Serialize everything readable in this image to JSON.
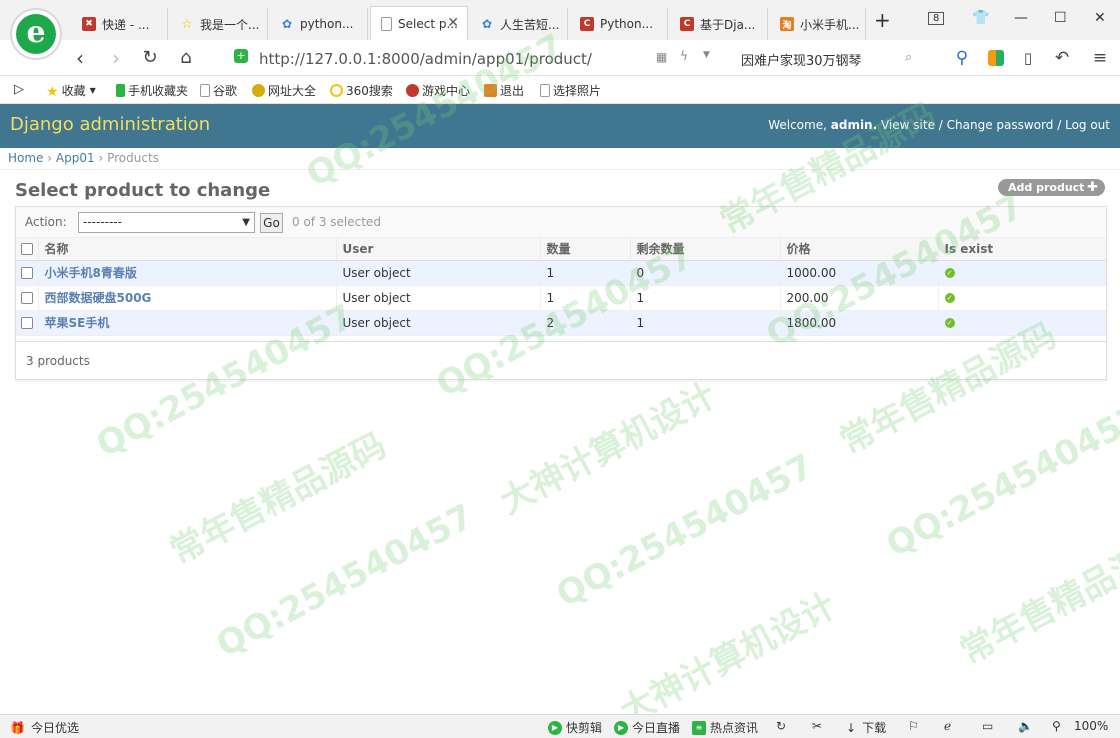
{
  "browser": {
    "tabs": [
      {
        "label": "快递 - ..."
      },
      {
        "label": "我是一个..."
      },
      {
        "label": "python..."
      },
      {
        "label": "Select p..."
      },
      {
        "label": "人生苦短..."
      },
      {
        "label": "Python..."
      },
      {
        "label": "基于Dja..."
      },
      {
        "label": "小米手机..."
      }
    ],
    "tab_count": "8",
    "url": "http://127.0.0.1:8000/admin/app01/product/",
    "search_text": "因难户家现30万钢琴",
    "bookmarks": [
      "收藏",
      "手机收藏夹",
      "谷歌",
      "网址大全",
      "360搜索",
      "游戏中心",
      "退出",
      "选择照片"
    ]
  },
  "admin": {
    "site_name": "Django administration",
    "welcome": "Welcome,",
    "username": "admin.",
    "view_site": "View site",
    "change_password": "Change password",
    "logout": "Log out",
    "sep": "/"
  },
  "breadcrumbs": {
    "home": "Home",
    "app": "App01",
    "current": "Products",
    "sep": "›"
  },
  "page": {
    "title": "Select product to change",
    "add_button": "Add product"
  },
  "actions": {
    "label": "Action:",
    "selected_option": "---------",
    "go": "Go",
    "selected_count": "0 of 3 selected"
  },
  "table": {
    "headers": [
      "名称",
      "User",
      "数量",
      "剩余数量",
      "价格",
      "Is exist"
    ],
    "rows": [
      {
        "name": "小米手机8青春版",
        "user": "User object",
        "qty": "1",
        "remain": "0",
        "price": "1000.00"
      },
      {
        "name": "西部数据硬盘500G",
        "user": "User object",
        "qty": "1",
        "remain": "1",
        "price": "200.00"
      },
      {
        "name": "苹果SE手机",
        "user": "User object",
        "qty": "2",
        "remain": "1",
        "price": "1800.00"
      }
    ]
  },
  "paginator": "3 products",
  "watermark": {
    "lines": [
      "QQ:254540457",
      "常年售精品源码",
      "大神计算机设计"
    ]
  },
  "statusbar": {
    "left": "今日优选",
    "items": [
      "快剪辑",
      "今日直播",
      "热点资讯",
      "下载"
    ],
    "zoom": "100%"
  }
}
